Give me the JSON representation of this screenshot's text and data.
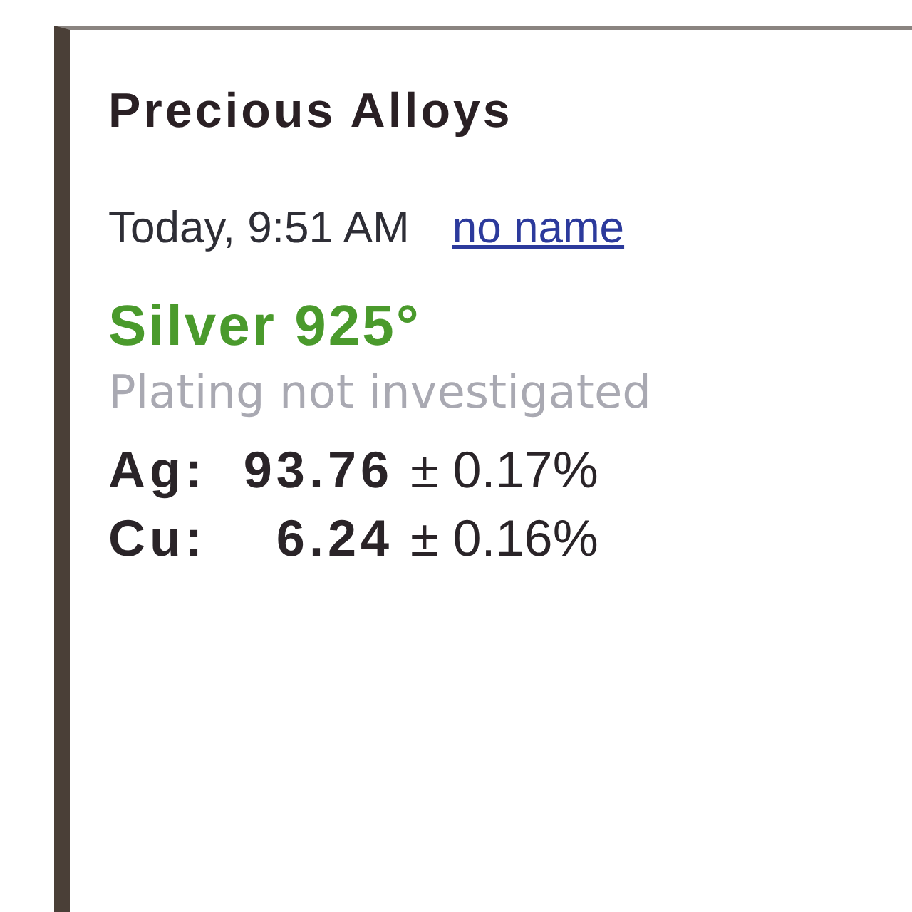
{
  "window": {
    "title": "Precious Alloys"
  },
  "measurement": {
    "timestamp": "Today, 9:51 AM",
    "operator_link": "no name"
  },
  "result": {
    "grade": "Silver 925°",
    "plating_note": "Plating not investigated"
  },
  "composition": [
    {
      "element": "Ag:",
      "value": "93.76",
      "uncertainty": "± 0.17%"
    },
    {
      "element": "Cu:",
      "value": "6.24",
      "uncertainty": "± 0.16%"
    }
  ]
}
